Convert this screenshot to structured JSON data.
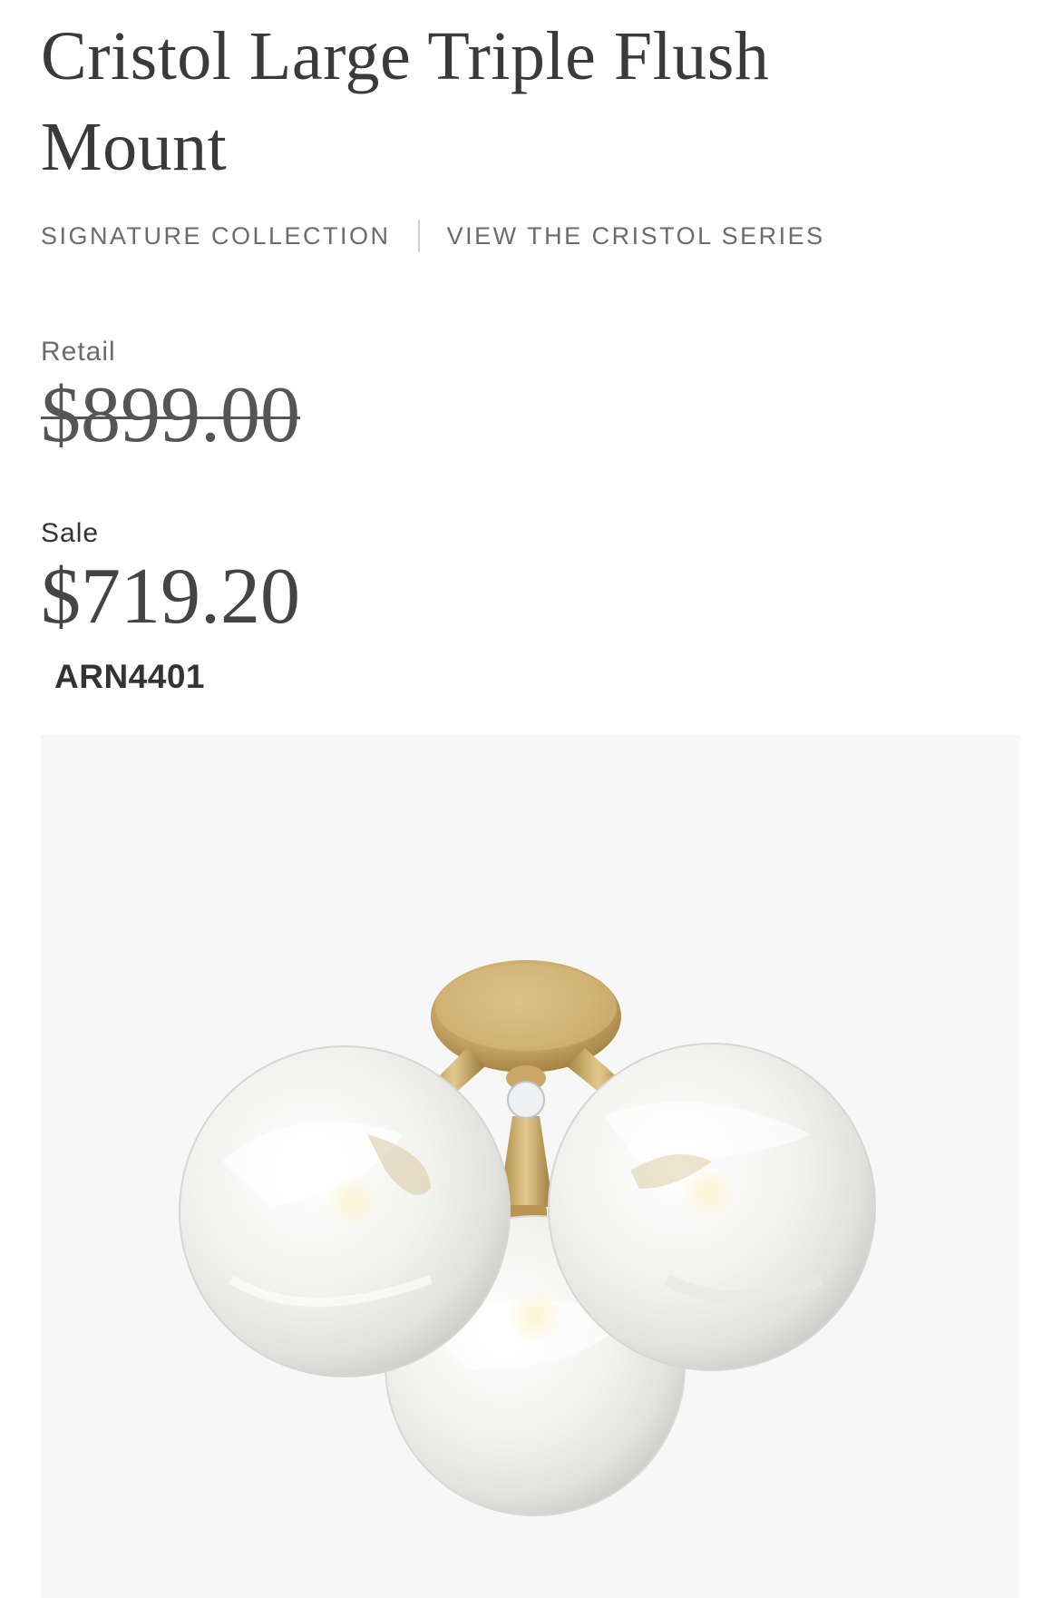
{
  "product": {
    "title": "Cristol Large Triple Flush Mount",
    "collection_link": "SIGNATURE COLLECTION",
    "series_link": "VIEW THE CRISTOL SERIES",
    "retail_label": "Retail",
    "retail_price": "$899.00",
    "sale_label": "Sale",
    "sale_price": "$719.20",
    "sku": "ARN4401"
  },
  "image": {
    "subject": "brass-flush-mount-with-three-swirled-glass-globes",
    "background": "#f7f7f7",
    "accent_brass": "#c9a867"
  }
}
